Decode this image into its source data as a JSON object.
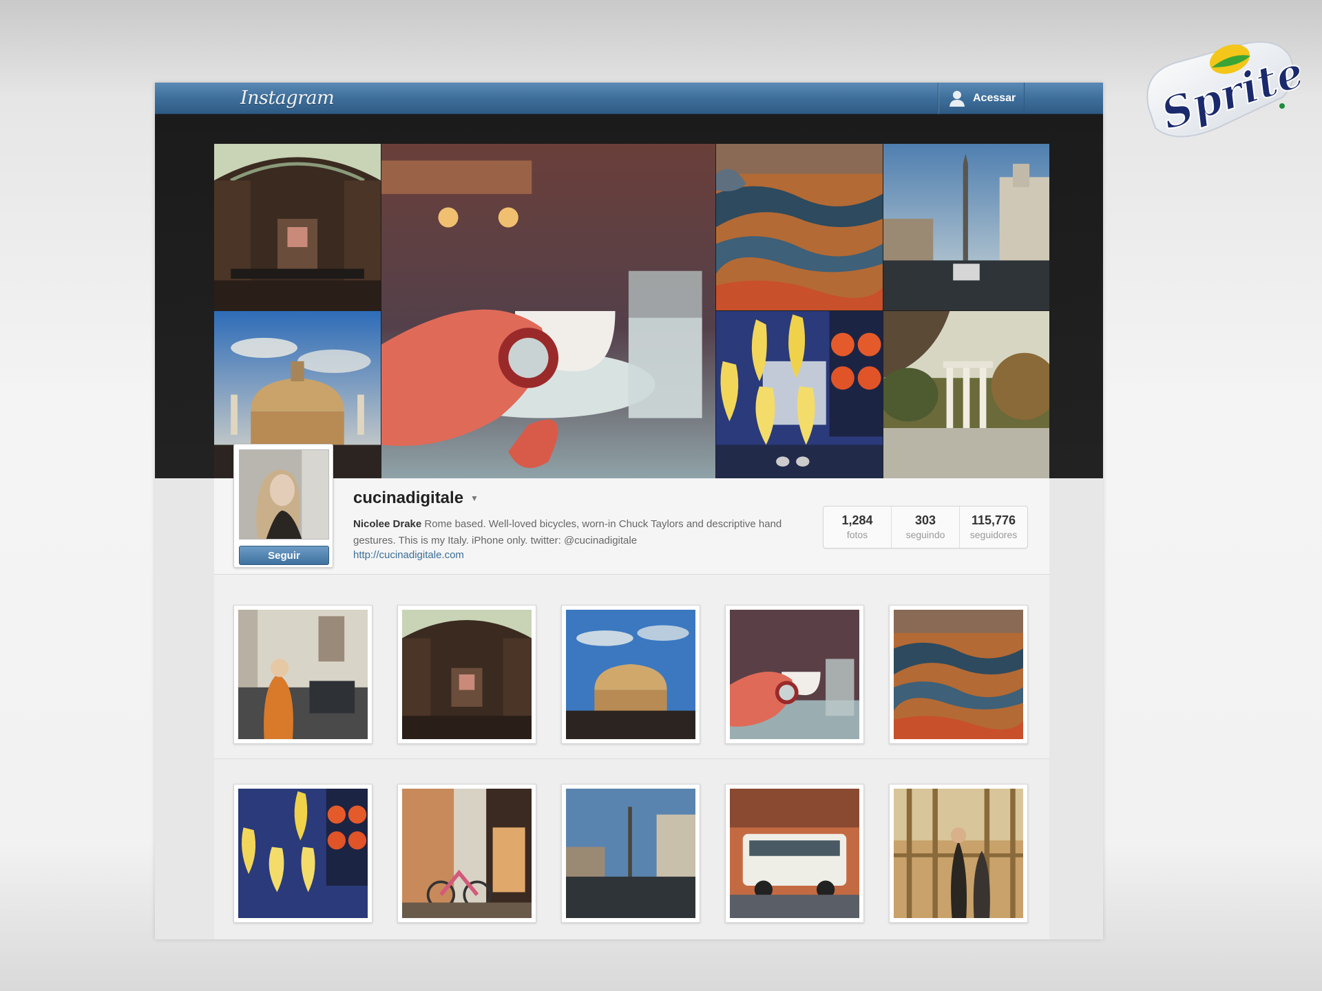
{
  "app": {
    "brand": "Instagram",
    "login_label": "Acessar"
  },
  "hero": {
    "tiles": [
      {
        "name": "hero-library-hall"
      },
      {
        "name": "hero-coffee-ring"
      },
      {
        "name": "hero-fountain-water"
      },
      {
        "name": "hero-piazza-obelisk"
      },
      {
        "name": "hero-castel-sant-angelo"
      },
      {
        "name": "hero-bananas-market"
      },
      {
        "name": "hero-temple-park"
      }
    ]
  },
  "profile": {
    "username": "cucinadigitale",
    "display_name": "Nicolee Drake",
    "bio": " Rome based. Well-loved bicycles, worn-in Chuck Taylors and descriptive hand gestures. This is my Italy. iPhone only. twitter: @cucinadigitale",
    "website": "http://cucinadigitale.com",
    "follow_label": "Seguir",
    "stats": [
      {
        "value": "1,284",
        "label": "fotos"
      },
      {
        "value": "303",
        "label": "seguindo"
      },
      {
        "value": "115,776",
        "label": "seguidores"
      }
    ]
  },
  "sponsor": {
    "logo_text": "Sprite"
  },
  "colors": {
    "nav_blue": "#3e6f9b",
    "link_blue": "#3b6e99",
    "sprite_green": "#1c8d3a",
    "sprite_navy": "#1a2a6c"
  }
}
